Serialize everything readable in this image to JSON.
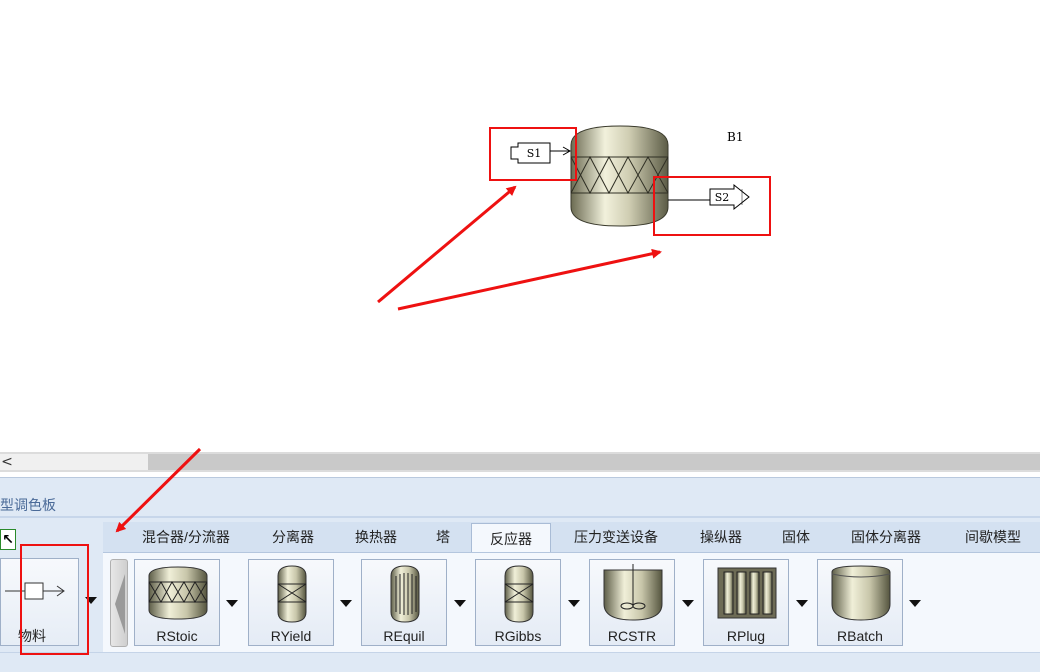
{
  "canvas": {
    "block_label": "B1",
    "stream_in_label": "S1",
    "stream_out_label": "S2"
  },
  "scrollbar": {
    "left_arrow": "<"
  },
  "palette": {
    "title": "模型调色板",
    "tabs": [
      {
        "label": "混合器/分流器"
      },
      {
        "label": "分离器"
      },
      {
        "label": "换热器"
      },
      {
        "label": "塔"
      },
      {
        "label": "反应器"
      },
      {
        "label": "压力变送设备"
      },
      {
        "label": "操纵器"
      },
      {
        "label": "固体"
      },
      {
        "label": "固体分离器"
      },
      {
        "label": "间歇模型"
      }
    ],
    "active_tab": "反应器",
    "material_label": "物料",
    "pointer_symbol": "↖",
    "tools": [
      {
        "label": "RStoic",
        "icon": "rstoic-reactor-icon"
      },
      {
        "label": "RYield",
        "icon": "ryield-reactor-icon"
      },
      {
        "label": "REquil",
        "icon": "requil-reactor-icon"
      },
      {
        "label": "RGibbs",
        "icon": "rgibbs-reactor-icon"
      },
      {
        "label": "RCSTR",
        "icon": "rcstr-reactor-icon"
      },
      {
        "label": "RPlug",
        "icon": "rplug-reactor-icon"
      },
      {
        "label": "RBatch",
        "icon": "rbatch-reactor-icon"
      }
    ]
  },
  "colors": {
    "highlight": "#e11111",
    "palette_bg": "#dfe9f5",
    "tool_bg": "#f4f8fd"
  }
}
